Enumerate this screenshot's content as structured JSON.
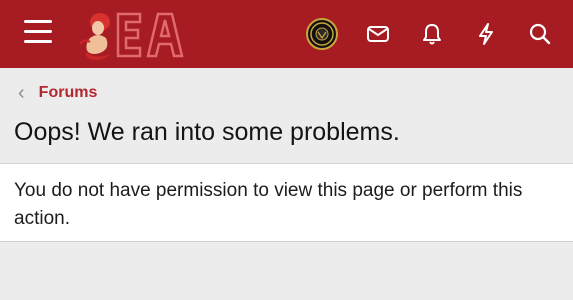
{
  "header": {
    "logo_text": "EA",
    "icons": [
      "menu-icon",
      "mail-icon",
      "bell-icon",
      "lightning-icon",
      "search-icon"
    ],
    "bg_color": "#a61c22"
  },
  "breadcrumb": {
    "label": "Forums"
  },
  "page": {
    "title": "Oops! We ran into some problems.",
    "message": "You do not have permission to view this page or perform this action."
  }
}
